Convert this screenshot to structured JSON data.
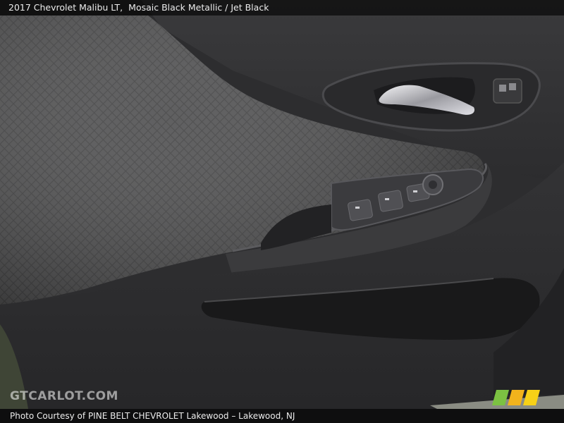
{
  "header": {
    "vehicle": "2017 Chevrolet Malibu LT,",
    "color": "Mosaic Black Metallic / Jet Black"
  },
  "footer": {
    "credit": "Photo Courtesy of PINE BELT CHEVROLET Lakewood – Lakewood, NJ"
  },
  "watermark": {
    "text": "GTCARLOT.COM"
  },
  "logo": {
    "stripe_colors": [
      "#7cc242",
      "#f2b31c",
      "#f7d117"
    ]
  }
}
